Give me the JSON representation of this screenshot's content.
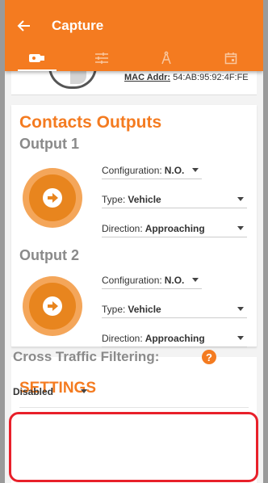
{
  "header": {
    "title": "Capture",
    "tabs": [
      {
        "icon": "camera-icon",
        "active": true
      },
      {
        "icon": "sliders-icon",
        "active": false
      },
      {
        "icon": "compass-icon",
        "active": false
      },
      {
        "icon": "calendar-icon",
        "active": false
      }
    ]
  },
  "device": {
    "mac_label": "MAC Addr:",
    "mac_value": "54:AB:95:92:4F:FE"
  },
  "contacts": {
    "title": "Contacts Outputs",
    "outputs": [
      {
        "title": "Output 1",
        "configuration_label": "Configuration:",
        "configuration_value": "N.O.",
        "type_label": "Type:",
        "type_value": "Vehicle",
        "direction_label": "Direction:",
        "direction_value": "Approaching"
      },
      {
        "title": "Output 2",
        "configuration_label": "Configuration:",
        "configuration_value": "N.O.",
        "type_label": "Type:",
        "type_value": "Vehicle",
        "direction_label": "Direction:",
        "direction_value": "Approaching"
      }
    ]
  },
  "settings": {
    "title": "SETTINGS",
    "cross_traffic_label": "Cross Traffic Filtering:",
    "help_glyph": "?",
    "cross_traffic_value": "Disabled"
  },
  "colors": {
    "accent": "#f47b20",
    "highlight": "#e8202a"
  }
}
